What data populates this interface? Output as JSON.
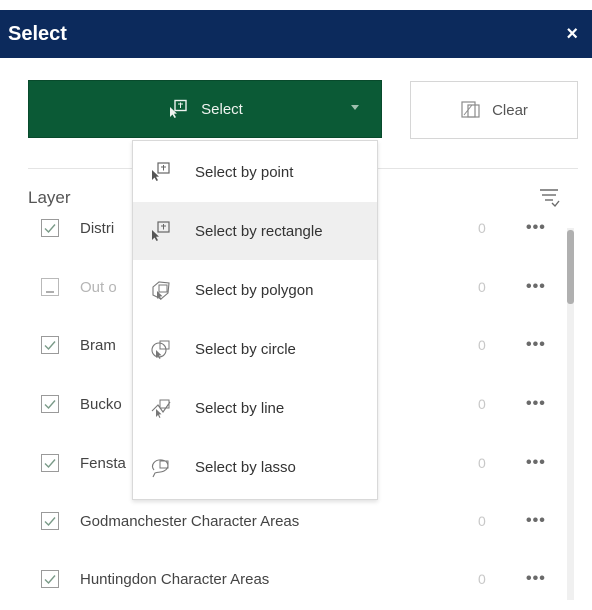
{
  "panel": {
    "title": "Select",
    "close_glyph": "×",
    "select_button_label": "Select",
    "clear_button_label": "Clear",
    "layer_header": "Layer"
  },
  "dropdown": {
    "items": [
      {
        "label": "Select by point",
        "icon": "select-point-icon",
        "active": false
      },
      {
        "label": "Select by rectangle",
        "icon": "select-rectangle-icon",
        "active": true
      },
      {
        "label": "Select by polygon",
        "icon": "select-polygon-icon",
        "active": false
      },
      {
        "label": "Select by circle",
        "icon": "select-circle-icon",
        "active": false
      },
      {
        "label": "Select by line",
        "icon": "select-line-icon",
        "active": false
      },
      {
        "label": "Select by lasso",
        "icon": "select-lasso-icon",
        "active": false
      }
    ]
  },
  "layers": [
    {
      "name": "Distri",
      "count": "0",
      "checked": true,
      "enabled": true
    },
    {
      "name": "Out o",
      "count": "0",
      "checked": false,
      "enabled": false
    },
    {
      "name": "Bram",
      "count": "0",
      "checked": true,
      "enabled": true
    },
    {
      "name": "Bucko",
      "count": "0",
      "checked": true,
      "enabled": true
    },
    {
      "name": "Fensta",
      "count": "0",
      "checked": true,
      "enabled": true
    },
    {
      "name": "Godmanchester Character Areas",
      "count": "0",
      "checked": true,
      "enabled": true
    },
    {
      "name": "Huntingdon Character Areas",
      "count": "0",
      "checked": true,
      "enabled": true
    }
  ],
  "more_glyph": "•••",
  "colors": {
    "title_bar": "#0c2a5c",
    "select_button": "#0b5a36",
    "dropdown_active": "#efefef"
  }
}
